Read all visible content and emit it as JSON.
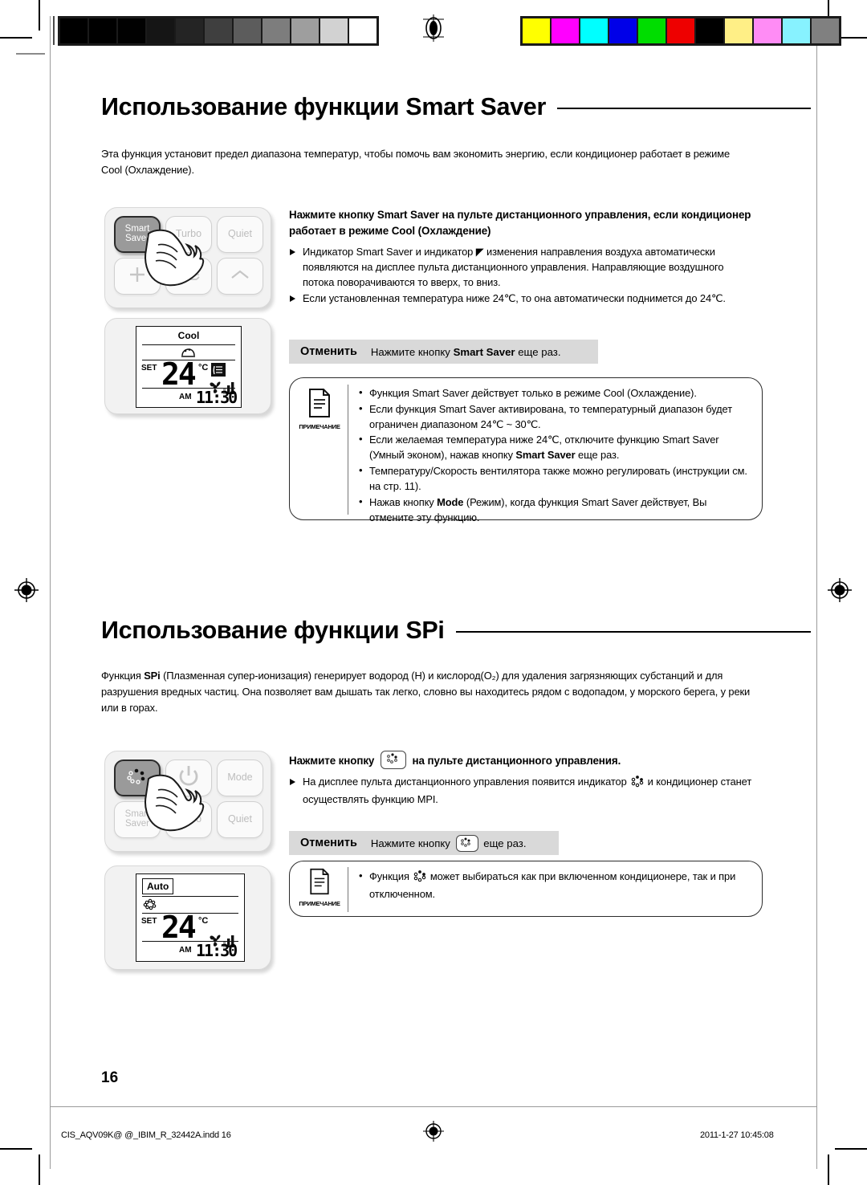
{
  "document": {
    "page_number": "16",
    "footer_left": "CIS_AQV09K@ @_IBIM_R_32442A.indd   16",
    "footer_right": "2011-1-27   10:45:08"
  },
  "calibration": {
    "grayscale_steps": [
      "#000000",
      "#000000",
      "#010101",
      "#151515",
      "#242424",
      "#3f3f3f",
      "#5c5c5c",
      "#7d7d7d",
      "#9e9e9e",
      "#d2d2d2",
      "#ffffff"
    ],
    "color_swatches": [
      "#ffff00",
      "#ff00ff",
      "#00ffff",
      "#0000e8",
      "#00dd00",
      "#ee0000",
      "#000000",
      "#ffef86",
      "#ff8cf5",
      "#87f2ff",
      "#808080"
    ]
  },
  "sections": [
    {
      "id": "smart-saver",
      "heading": "Использование функции Smart Saver",
      "intro": "Эта функция установит предел диапазона температур, чтобы помочь вам экономить энергию, если кондиционер работает в режиме Cool (Охлаждение).",
      "remote": {
        "buttons": [
          {
            "label": "Smart Saver",
            "state": "highlighted",
            "icon": ""
          },
          {
            "label": "Turbo",
            "state": "normal",
            "icon": ""
          },
          {
            "label": "Quiet",
            "state": "normal",
            "icon": ""
          },
          {
            "label": "",
            "state": "normal",
            "icon": "plus-icon"
          },
          {
            "label": "",
            "state": "normal",
            "icon": "airflow-icon"
          },
          {
            "label": "",
            "state": "normal",
            "icon": "chevron-up-icon"
          }
        ],
        "display": {
          "mode": "Cool",
          "indicator_icon": "smart-saver-indicator-icon",
          "set_label": "SET",
          "temperature": "24",
          "unit": "°C",
          "airflow_icon": "airflow-direction-icon",
          "fan_icon": "fan-icon",
          "fan_bars": 3,
          "meridiem": "AM",
          "time": "11:30"
        }
      },
      "instruction": {
        "title_parts": [
          {
            "t": "Нажмите  кнопку ",
            "b": false
          },
          {
            "t": "Smart Saver",
            "b": true
          },
          {
            "t": " на пульте дистанционного управления, если кондиционер работает в режиме Cool (Охлаждение)",
            "b": false
          }
        ],
        "bullets": [
          "Индикатор Smart Saver и индикатор ◤ изменения направления воздуха автоматически появляются на дисплее пульта дистанционного управления. Направляющие воздушного потока поворачиваются то вверх, то вниз.",
          "Если установленная температура ниже 24℃, то она автоматически поднимется до 24℃."
        ]
      },
      "cancel": {
        "label": "Отменить",
        "text_parts": [
          {
            "t": "Нажмите  кнопку ",
            "b": false
          },
          {
            "t": "Smart Saver",
            "b": true
          },
          {
            "t": " еще раз.",
            "b": false
          }
        ]
      },
      "note": {
        "icon_caption": "ПРИМЕЧАНИЕ",
        "items": [
          [
            {
              "t": "Функция Smart Saver действует только в режиме Cool (Охлаждение).",
              "b": false
            }
          ],
          [
            {
              "t": "Если функция Smart Saver активирована, то температурный диапазон будет ограничен диапазоном 24℃ ~ 30℃.",
              "b": false
            }
          ],
          [
            {
              "t": "Если желаемая температура ниже 24℃, отключите функцию Smart Saver (Умный эконом), нажав кнопку ",
              "b": false
            },
            {
              "t": "Smart Saver",
              "b": true
            },
            {
              "t": " еще раз.",
              "b": false
            }
          ],
          [
            {
              "t": "Температуру/Скорость вентилятора также можно регулировать (инструкции см. на стр. 11).",
              "b": false
            }
          ],
          [
            {
              "t": "Нажав кнопку ",
              "b": false
            },
            {
              "t": "Mode",
              "b": true
            },
            {
              "t": " (Режим), когда функция Smart Saver действует, Вы отмените эту функцию.",
              "b": false
            }
          ]
        ]
      }
    },
    {
      "id": "spi",
      "heading_parts": [
        {
          "t": "Использование функции ",
          "b": false
        },
        {
          "t": "SPi",
          "b": true
        }
      ],
      "heading": "Использование функции SPi",
      "intro_parts": [
        {
          "t": "Функция ",
          "b": false
        },
        {
          "t": "SPi",
          "b": true
        },
        {
          "t": " (Плазменная супер-ионизация) генерирует водород (Н) и кислород(О₂) для удаления загрязняющих субстанций и для разрушения вредных частиц. Она позволяет вам дышать так легко, словно вы находитесь рядом с водопадом, у морского берега, у реки или в горах.",
          "b": false
        }
      ],
      "remote": {
        "buttons": [
          {
            "label": "",
            "state": "highlighted",
            "icon": "spi-icon"
          },
          {
            "label": "",
            "state": "normal",
            "icon": "power-icon"
          },
          {
            "label": "Mode",
            "state": "normal",
            "icon": ""
          },
          {
            "label": "Smart Saver",
            "state": "normal",
            "icon": ""
          },
          {
            "label": "Turbo",
            "state": "normal",
            "icon": ""
          },
          {
            "label": "Quiet",
            "state": "normal",
            "icon": ""
          }
        ],
        "display": {
          "mode": "Auto",
          "indicator_icon": "spi-indicator-icon",
          "set_label": "SET",
          "temperature": "24",
          "unit": "°C",
          "fan_icon": "fan-icon",
          "fan_bars": 3,
          "meridiem": "AM",
          "time": "11:30"
        }
      },
      "instruction": {
        "title_parts": [
          {
            "t": "Нажмите кнопку ",
            "b": true
          },
          {
            "t": "[SPi]",
            "b": false
          },
          {
            "t": " на пульте дистанционного управления.",
            "b": true
          }
        ],
        "title_pre": "Нажмите кнопку",
        "title_post": "на пульте дистанционного управления.",
        "bullet_pre": "На дисплее пульта дистанционного управления появится индикатор",
        "bullet_post": "и кондиционер станет осуществлять функцию MPI."
      },
      "cancel": {
        "label": "Отменить",
        "text_pre": "Нажмите  кнопку",
        "text_post": "еще раз."
      },
      "note": {
        "icon_caption": "ПРИМЕЧАНИЕ",
        "item_pre": "Функция",
        "item_post": "может выбираться как при включенном кондиционере, так и при отключенном."
      }
    }
  ]
}
